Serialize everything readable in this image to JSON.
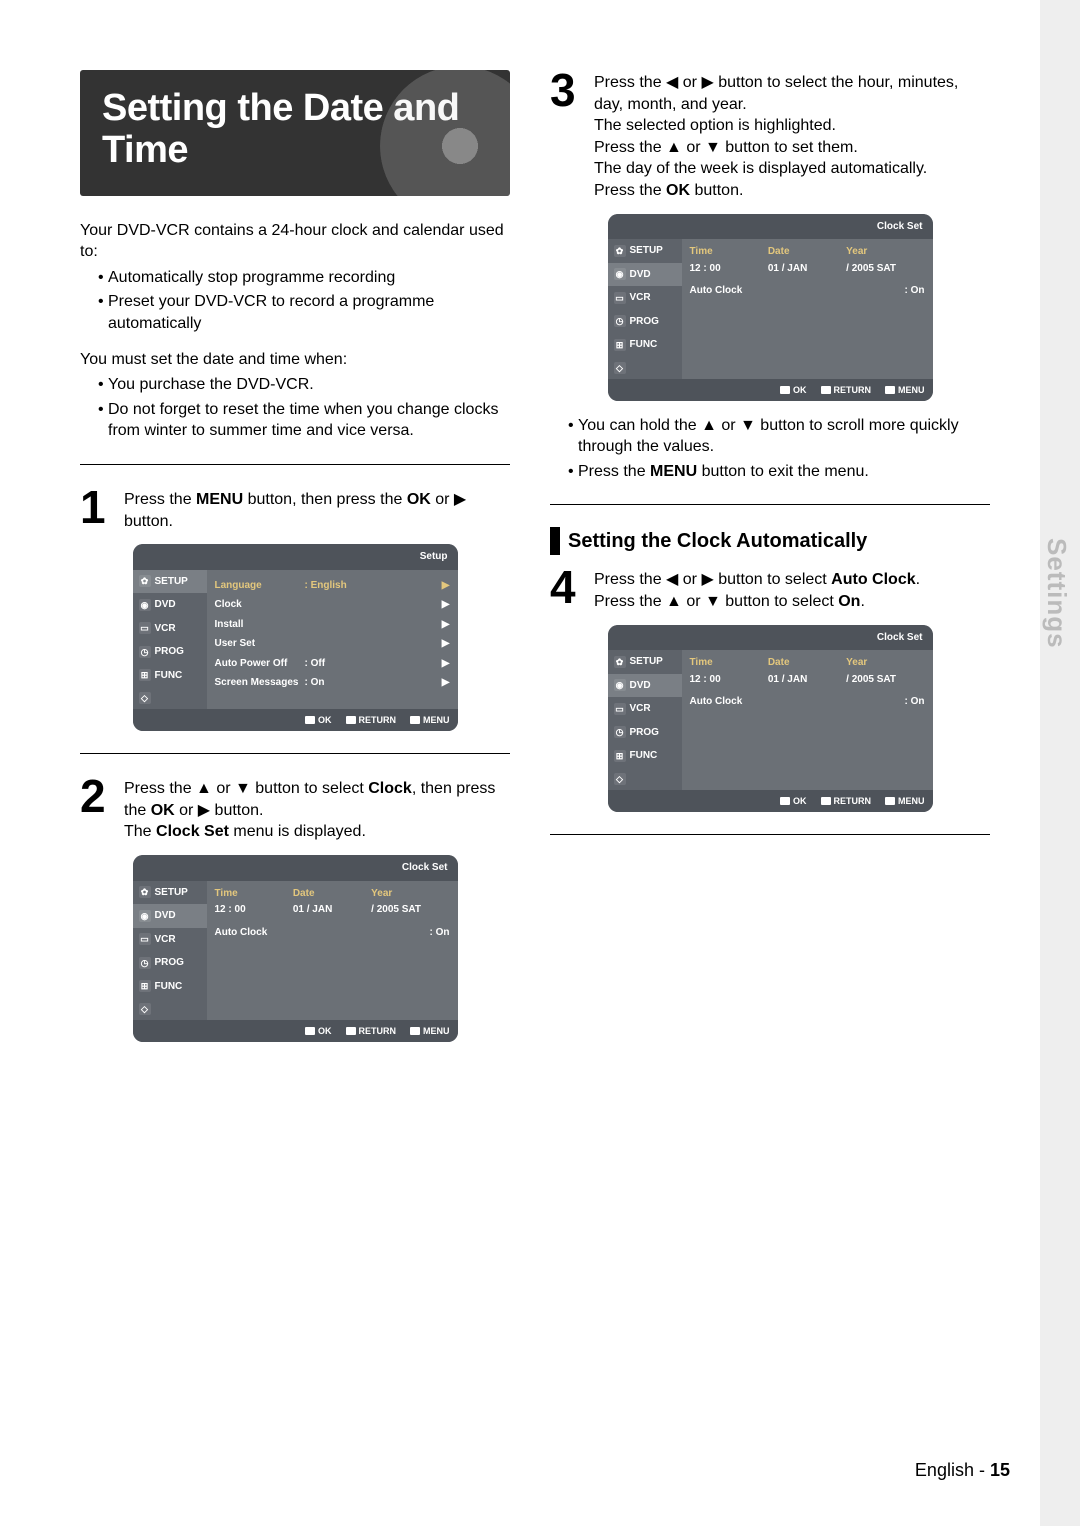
{
  "hero_title": "Setting the Date and Time",
  "intro_lead": "Your DVD-VCR contains a 24-hour clock and calendar used to:",
  "intro_bullets": [
    "Automatically stop programme recording",
    "Preset your DVD-VCR to record a programme automatically"
  ],
  "intro_must": "You must set the date and time when:",
  "intro_must_bullets": [
    "You purchase the DVD-VCR.",
    "Do not forget to reset the time when you change clocks from winter to summer time and vice versa."
  ],
  "step1_a": "Press the ",
  "step1_menu": "MENU",
  "step1_b": " button, then press the ",
  "step1_ok": "OK",
  "step1_c": " or ▶ button.",
  "step2_a": "Press the ▲ or ▼ button to select ",
  "step2_clock": "Clock",
  "step2_b": ", then press the ",
  "step2_ok": "OK",
  "step2_c": " or ▶ button.",
  "step2_d": "The ",
  "step2_csm": "Clock Set",
  "step2_e": " menu is displayed.",
  "step3_lines": [
    "Press the ◀ or ▶ button to select the hour, minutes, day, month, and year.",
    "The selected option is highlighted.",
    "Press the ▲ or ▼ button to set them.",
    "The day of the week is displayed automatically."
  ],
  "step3_press": "Press the ",
  "step3_ok": "OK",
  "step3_btn": " button.",
  "step3_notes_a1": "You can hold the ▲ or ▼ button to scroll more quickly through the values.",
  "step3_notes_b_pre": "Press the ",
  "step3_notes_b_mid": "MENU",
  "step3_notes_b_post": " button to exit the menu.",
  "subheading": "Setting the Clock Automatically",
  "step4_a": "Press the ◀ or ▶ button to select ",
  "step4_ac": "Auto Clock",
  "step4_b": ".",
  "step4_c": "Press the ▲ or ▼ button to select ",
  "step4_on": "On",
  "step4_d": ".",
  "side_tab": "Settings",
  "footer_lang": "English",
  "footer_page": "15",
  "osd_setup": {
    "title": "Setup",
    "tabs": [
      "SETUP",
      "DVD",
      "VCR",
      "PROG",
      "FUNC"
    ],
    "rows": [
      {
        "l": "Language",
        "r": ": English",
        "arr": true
      },
      {
        "l": "Clock",
        "r": "",
        "arr": true
      },
      {
        "l": "Install",
        "r": "",
        "arr": true
      },
      {
        "l": "User Set",
        "r": "",
        "arr": true
      },
      {
        "l": "Auto Power Off",
        "r": ": Off",
        "arr": true
      },
      {
        "l": "Screen Messages",
        "r": ": On",
        "arr": true
      }
    ],
    "bar": [
      "OK",
      "RETURN",
      "MENU"
    ]
  },
  "osd_clock": {
    "title": "Clock Set",
    "tabs": [
      "SETUP",
      "DVD",
      "VCR",
      "PROG",
      "FUNC"
    ],
    "cols": [
      "Time",
      "Date",
      "Year"
    ],
    "vals": [
      "12 : 00",
      "01 / JAN",
      "/ 2005 SAT"
    ],
    "row2": {
      "l": "Auto Clock",
      "r": ": On"
    },
    "bar": [
      "OK",
      "RETURN",
      "MENU"
    ]
  }
}
